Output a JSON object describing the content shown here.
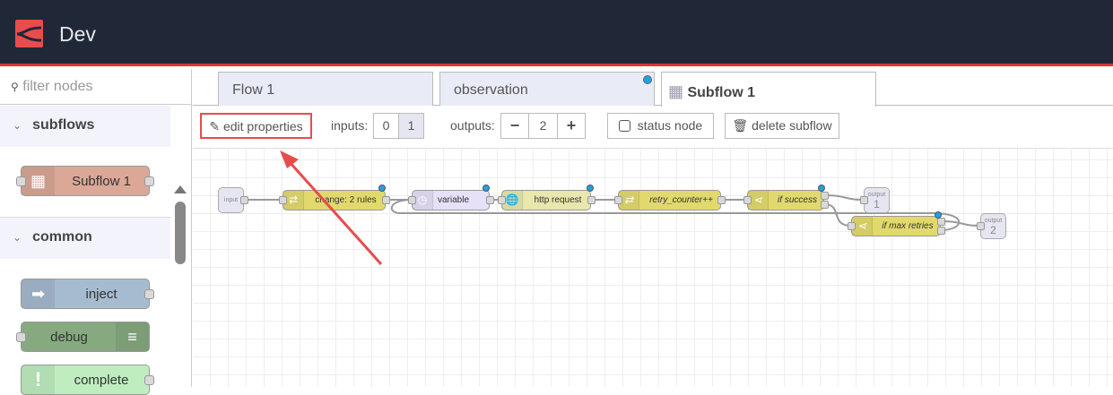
{
  "header": {
    "title": "Dev",
    "brand_color": "#e84c4c",
    "bg": "#202838"
  },
  "palette": {
    "filter_placeholder": "filter nodes",
    "categories": [
      {
        "label": "subflows",
        "nodes": [
          {
            "label": "Subflow 1",
            "icon": "subflow-icon",
            "color": "#dba897"
          }
        ]
      },
      {
        "label": "common",
        "nodes": [
          {
            "label": "inject",
            "icon": "inject-arrow-icon",
            "color": "#a6bbcf"
          },
          {
            "label": "debug",
            "icon": "debug-list-icon",
            "color": "#87a980"
          },
          {
            "label": "complete",
            "icon": "exclamation-icon",
            "color": "#c0edc0"
          }
        ]
      }
    ]
  },
  "tabs": [
    {
      "label": "Flow 1"
    },
    {
      "label": "observation",
      "changed": true
    },
    {
      "label": "Subflow 1",
      "active": true,
      "icon": "subflow-icon"
    }
  ],
  "toolbar": {
    "edit_properties": "edit properties",
    "inputs_label": "inputs:",
    "inputs_options": [
      "0",
      "1"
    ],
    "inputs_selected": "1",
    "outputs_label": "outputs:",
    "outputs_value": "2",
    "minus": "−",
    "plus": "+",
    "status_node": "status node",
    "status_checked": false,
    "delete_subflow": "delete subflow"
  },
  "flow": {
    "input": "input",
    "nodes": [
      {
        "label": "change: 2 rules",
        "icon": "shuffle-icon"
      },
      {
        "label": "variable",
        "icon": "timer-icon"
      },
      {
        "label": "http request",
        "icon": "globe-icon"
      },
      {
        "label": "retry_counter++",
        "icon": "shuffle-icon"
      },
      {
        "label": "if success",
        "icon": "switch-icon"
      },
      {
        "label": "if max retries",
        "icon": "switch-icon"
      }
    ],
    "outputs": [
      {
        "label": "output",
        "num": "1"
      },
      {
        "label": "output",
        "num": "2"
      }
    ]
  },
  "annotation": {
    "color": "#e84c4c"
  }
}
